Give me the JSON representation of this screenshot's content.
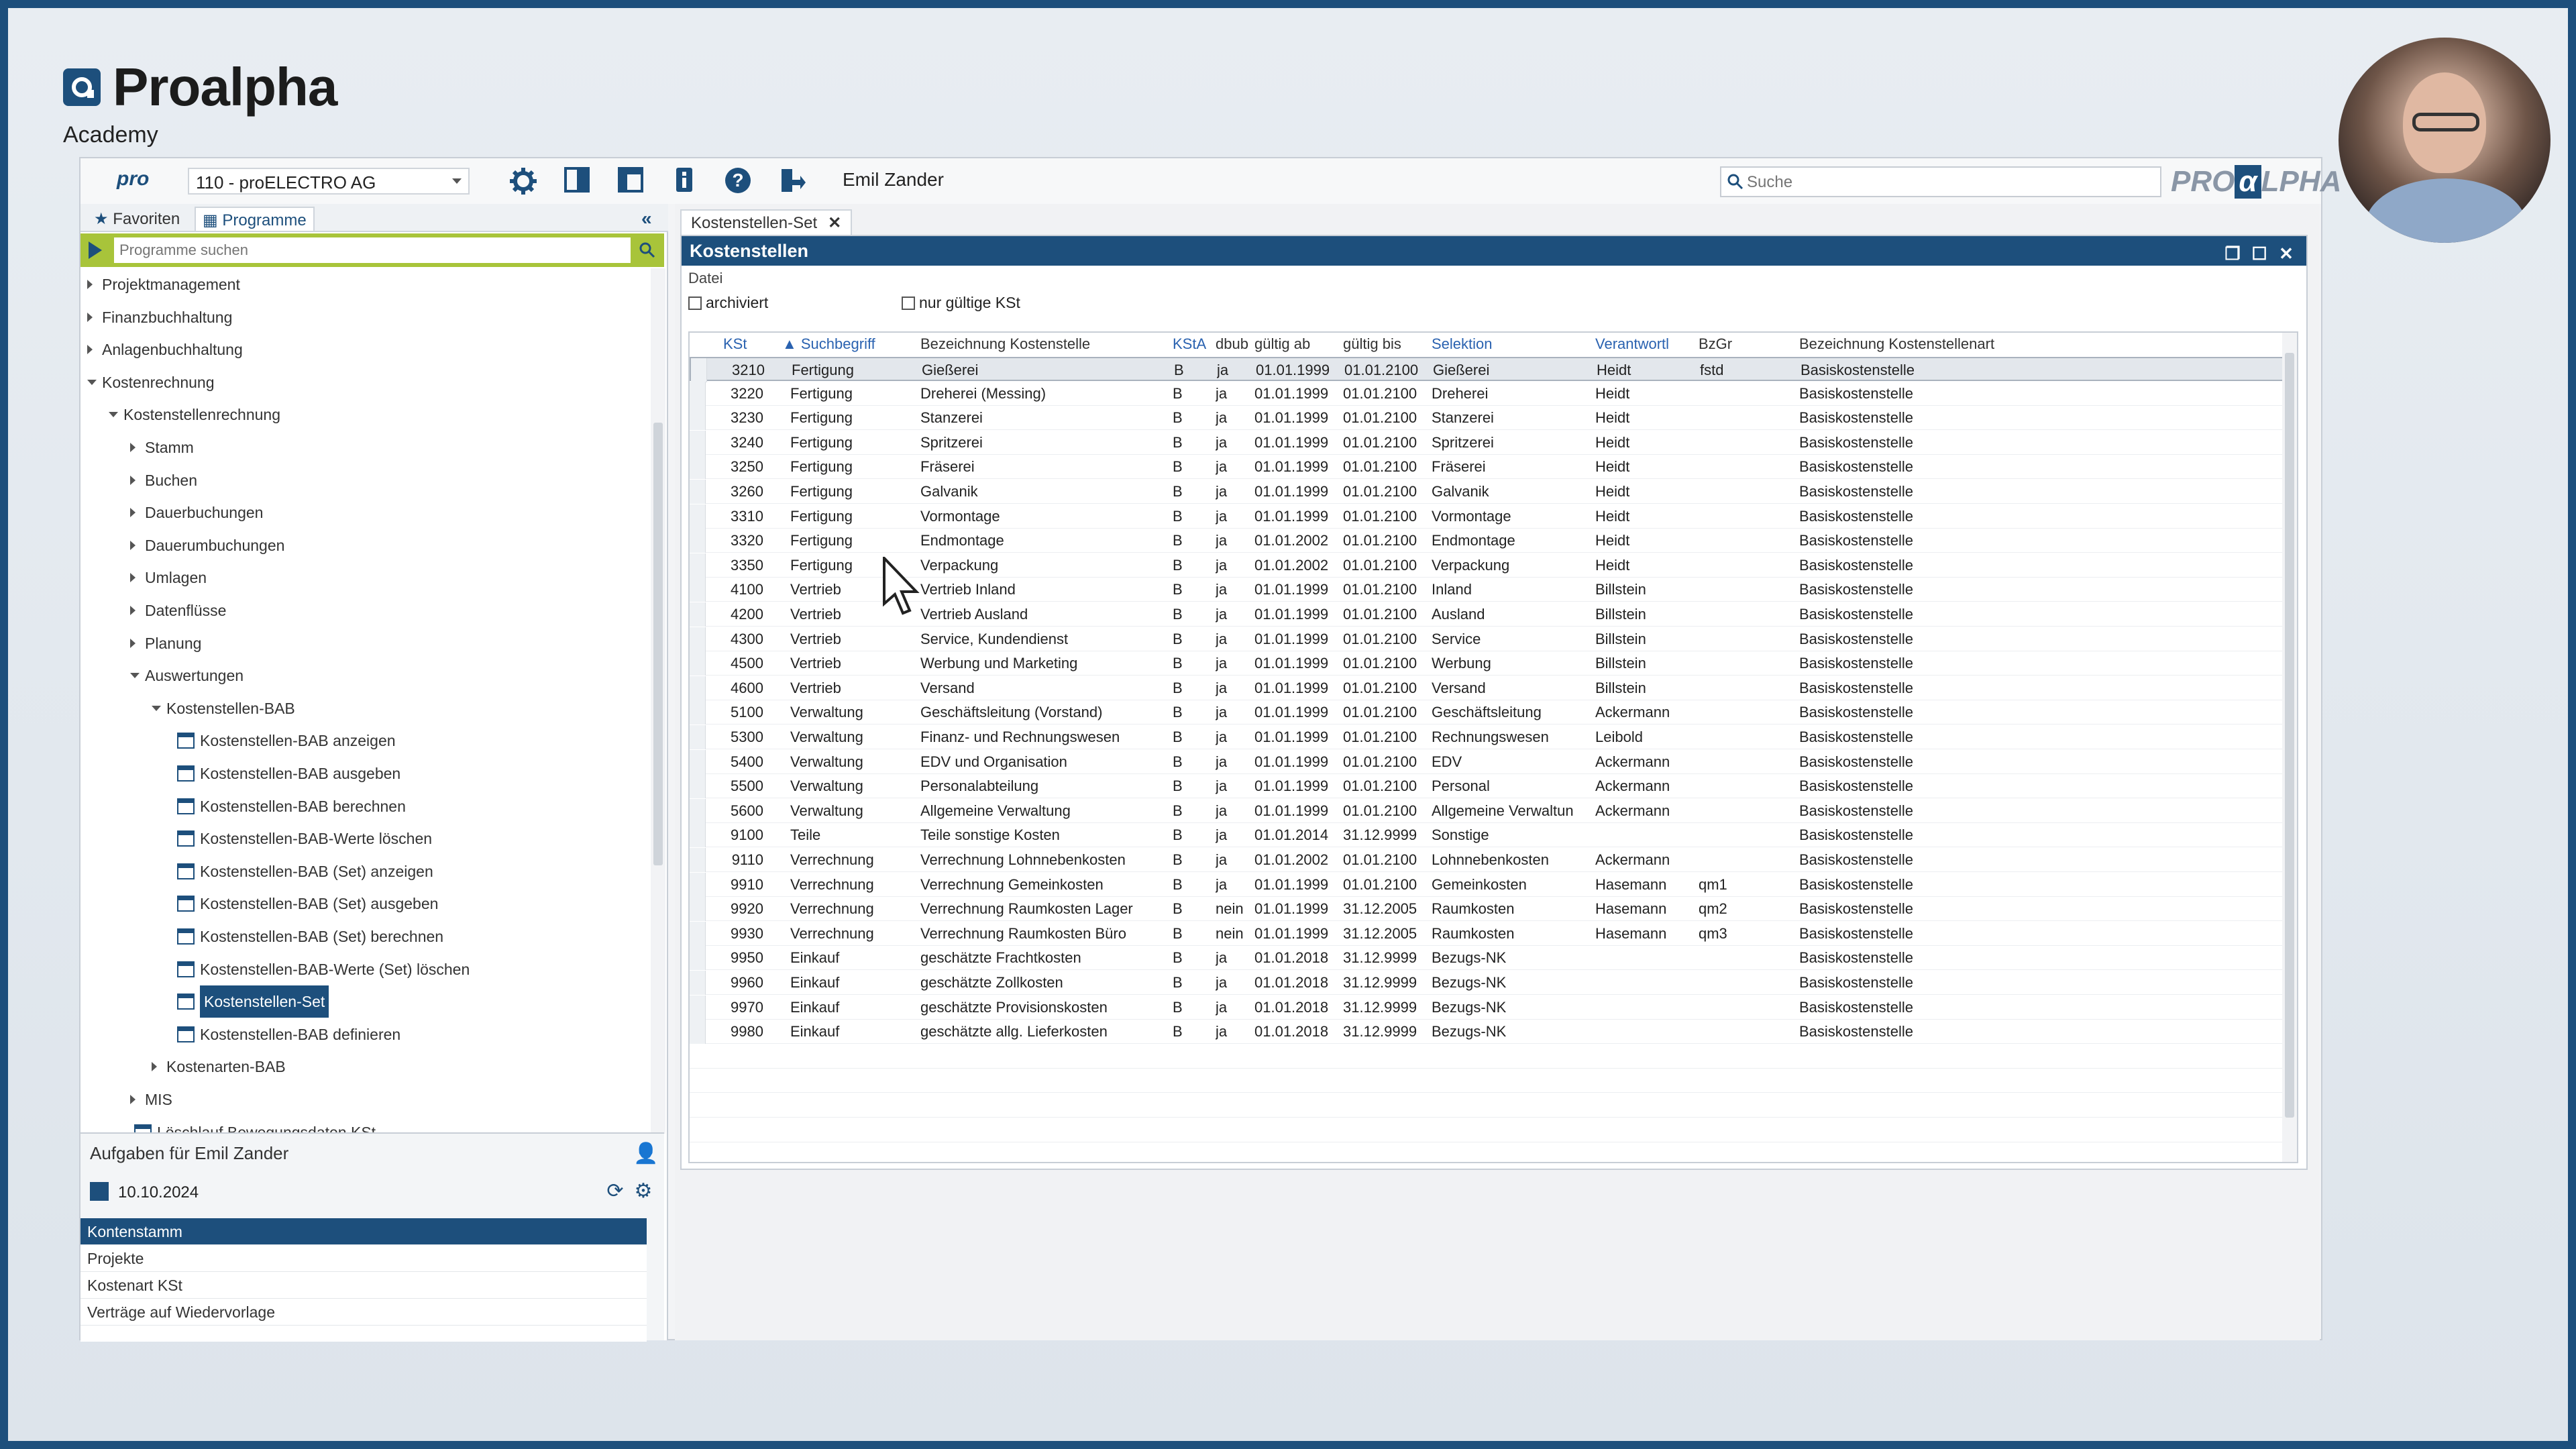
{
  "brand": {
    "name": "Proalpha",
    "sub": "Academy"
  },
  "toolbar": {
    "pro_mark": "pro",
    "company": "110 - proELECTRO AG",
    "user": "Emil Zander",
    "search_placeholder": "Suche",
    "logo_left": "PRO",
    "logo_alpha": "α",
    "logo_right": "LPHA"
  },
  "left_tabs": {
    "favorites": "Favoriten",
    "programs": "Programme"
  },
  "program_search": {
    "placeholder": "Programme suchen"
  },
  "tree": [
    {
      "label": "Projektmanagement",
      "level": 0,
      "state": "closed"
    },
    {
      "label": "Finanzbuchhaltung",
      "level": 0,
      "state": "closed"
    },
    {
      "label": "Anlagenbuchhaltung",
      "level": 0,
      "state": "closed"
    },
    {
      "label": "Kostenrechnung",
      "level": 0,
      "state": "open"
    },
    {
      "label": "Kostenstellenrechnung",
      "level": 1,
      "state": "open"
    },
    {
      "label": "Stamm",
      "level": 2,
      "state": "closed"
    },
    {
      "label": "Buchen",
      "level": 2,
      "state": "closed"
    },
    {
      "label": "Dauerbuchungen",
      "level": 2,
      "state": "closed"
    },
    {
      "label": "Dauerumbuchungen",
      "level": 2,
      "state": "closed"
    },
    {
      "label": "Umlagen",
      "level": 2,
      "state": "closed"
    },
    {
      "label": "Datenflüsse",
      "level": 2,
      "state": "closed"
    },
    {
      "label": "Planung",
      "level": 2,
      "state": "closed"
    },
    {
      "label": "Auswertungen",
      "level": 2,
      "state": "open"
    },
    {
      "label": "Kostenstellen-BAB",
      "level": 3,
      "state": "open"
    },
    {
      "label": "Kostenstellen-BAB anzeigen",
      "level": 4,
      "state": "leaf"
    },
    {
      "label": "Kostenstellen-BAB ausgeben",
      "level": 4,
      "state": "leaf"
    },
    {
      "label": "Kostenstellen-BAB berechnen",
      "level": 4,
      "state": "leaf"
    },
    {
      "label": "Kostenstellen-BAB-Werte löschen",
      "level": 4,
      "state": "leaf"
    },
    {
      "label": "Kostenstellen-BAB (Set) anzeigen",
      "level": 4,
      "state": "leaf"
    },
    {
      "label": "Kostenstellen-BAB (Set) ausgeben",
      "level": 4,
      "state": "leaf"
    },
    {
      "label": "Kostenstellen-BAB (Set) berechnen",
      "level": 4,
      "state": "leaf"
    },
    {
      "label": "Kostenstellen-BAB-Werte (Set) löschen",
      "level": 4,
      "state": "leaf"
    },
    {
      "label": "Kostenstellen-Set",
      "level": 4,
      "state": "leaf-selected"
    },
    {
      "label": "Kostenstellen-BAB definieren",
      "level": 4,
      "state": "leaf"
    },
    {
      "label": "Kostenarten-BAB",
      "level": 3,
      "state": "closed"
    },
    {
      "label": "MIS",
      "level": 2,
      "state": "closed"
    },
    {
      "label": "Löschlauf Bewegungsdaten KSt",
      "level": 2,
      "state": "leaf"
    }
  ],
  "tasks": {
    "title": "Aufgaben für Emil Zander",
    "date": "10.10.2024",
    "items": [
      "Kontenstamm",
      "Projekte",
      "Kostenart KSt",
      "Verträge auf Wiedervorlage"
    ]
  },
  "doc_tab": "Kostenstellen-Set",
  "panel": {
    "title": "Kostenstellen",
    "menu": "Datei",
    "check_archived": "archiviert",
    "check_valid": "nur gültige KSt"
  },
  "columns": [
    "KSt",
    "Suchbegriff",
    "Bezeichnung Kostenstelle",
    "KStA",
    "dbub",
    "gültig ab",
    "gültig bis",
    "Selektion",
    "Verantwortl",
    "BzGr",
    "Bezeichnung Kostenstellenart"
  ],
  "rows": [
    [
      "3210",
      "Fertigung",
      "Gießerei",
      "B",
      "ja",
      "01.01.1999",
      "01.01.2100",
      "Gießerei",
      "Heidt",
      "fstd",
      "Basiskostenstelle"
    ],
    [
      "3220",
      "Fertigung",
      "Dreherei (Messing)",
      "B",
      "ja",
      "01.01.1999",
      "01.01.2100",
      "Dreherei",
      "Heidt",
      "",
      "Basiskostenstelle"
    ],
    [
      "3230",
      "Fertigung",
      "Stanzerei",
      "B",
      "ja",
      "01.01.1999",
      "01.01.2100",
      "Stanzerei",
      "Heidt",
      "",
      "Basiskostenstelle"
    ],
    [
      "3240",
      "Fertigung",
      "Spritzerei",
      "B",
      "ja",
      "01.01.1999",
      "01.01.2100",
      "Spritzerei",
      "Heidt",
      "",
      "Basiskostenstelle"
    ],
    [
      "3250",
      "Fertigung",
      "Fräserei",
      "B",
      "ja",
      "01.01.1999",
      "01.01.2100",
      "Fräserei",
      "Heidt",
      "",
      "Basiskostenstelle"
    ],
    [
      "3260",
      "Fertigung",
      "Galvanik",
      "B",
      "ja",
      "01.01.1999",
      "01.01.2100",
      "Galvanik",
      "Heidt",
      "",
      "Basiskostenstelle"
    ],
    [
      "3310",
      "Fertigung",
      "Vormontage",
      "B",
      "ja",
      "01.01.1999",
      "01.01.2100",
      "Vormontage",
      "Heidt",
      "",
      "Basiskostenstelle"
    ],
    [
      "3320",
      "Fertigung",
      "Endmontage",
      "B",
      "ja",
      "01.01.2002",
      "01.01.2100",
      "Endmontage",
      "Heidt",
      "",
      "Basiskostenstelle"
    ],
    [
      "3350",
      "Fertigung",
      "Verpackung",
      "B",
      "ja",
      "01.01.2002",
      "01.01.2100",
      "Verpackung",
      "Heidt",
      "",
      "Basiskostenstelle"
    ],
    [
      "4100",
      "Vertrieb",
      "Vertrieb Inland",
      "B",
      "ja",
      "01.01.1999",
      "01.01.2100",
      "Inland",
      "Billstein",
      "",
      "Basiskostenstelle"
    ],
    [
      "4200",
      "Vertrieb",
      "Vertrieb Ausland",
      "B",
      "ja",
      "01.01.1999",
      "01.01.2100",
      "Ausland",
      "Billstein",
      "",
      "Basiskostenstelle"
    ],
    [
      "4300",
      "Vertrieb",
      "Service, Kundendienst",
      "B",
      "ja",
      "01.01.1999",
      "01.01.2100",
      "Service",
      "Billstein",
      "",
      "Basiskostenstelle"
    ],
    [
      "4500",
      "Vertrieb",
      "Werbung und Marketing",
      "B",
      "ja",
      "01.01.1999",
      "01.01.2100",
      "Werbung",
      "Billstein",
      "",
      "Basiskostenstelle"
    ],
    [
      "4600",
      "Vertrieb",
      "Versand",
      "B",
      "ja",
      "01.01.1999",
      "01.01.2100",
      "Versand",
      "Billstein",
      "",
      "Basiskostenstelle"
    ],
    [
      "5100",
      "Verwaltung",
      "Geschäftsleitung (Vorstand)",
      "B",
      "ja",
      "01.01.1999",
      "01.01.2100",
      "Geschäftsleitung",
      "Ackermann",
      "",
      "Basiskostenstelle"
    ],
    [
      "5300",
      "Verwaltung",
      "Finanz- und Rechnungswesen",
      "B",
      "ja",
      "01.01.1999",
      "01.01.2100",
      "Rechnungswesen",
      "Leibold",
      "",
      "Basiskostenstelle"
    ],
    [
      "5400",
      "Verwaltung",
      "EDV und Organisation",
      "B",
      "ja",
      "01.01.1999",
      "01.01.2100",
      "EDV",
      "Ackermann",
      "",
      "Basiskostenstelle"
    ],
    [
      "5500",
      "Verwaltung",
      "Personalabteilung",
      "B",
      "ja",
      "01.01.1999",
      "01.01.2100",
      "Personal",
      "Ackermann",
      "",
      "Basiskostenstelle"
    ],
    [
      "5600",
      "Verwaltung",
      "Allgemeine Verwaltung",
      "B",
      "ja",
      "01.01.1999",
      "01.01.2100",
      "Allgemeine Verwaltun",
      "Ackermann",
      "",
      "Basiskostenstelle"
    ],
    [
      "9100",
      "Teile",
      "Teile sonstige Kosten",
      "B",
      "ja",
      "01.01.2014",
      "31.12.9999",
      "Sonstige",
      "",
      "",
      "Basiskostenstelle"
    ],
    [
      "9110",
      "Verrechnung",
      "Verrechnung Lohnnebenkosten",
      "B",
      "ja",
      "01.01.2002",
      "01.01.2100",
      "Lohnnebenkosten",
      "Ackermann",
      "",
      "Basiskostenstelle"
    ],
    [
      "9910",
      "Verrechnung",
      "Verrechnung Gemeinkosten",
      "B",
      "ja",
      "01.01.1999",
      "01.01.2100",
      "Gemeinkosten",
      "Hasemann",
      "qm1",
      "Basiskostenstelle"
    ],
    [
      "9920",
      "Verrechnung",
      "Verrechnung Raumkosten Lager",
      "B",
      "nein",
      "01.01.1999",
      "31.12.2005",
      "Raumkosten",
      "Hasemann",
      "qm2",
      "Basiskostenstelle"
    ],
    [
      "9930",
      "Verrechnung",
      "Verrechnung Raumkosten Büro",
      "B",
      "nein",
      "01.01.1999",
      "31.12.2005",
      "Raumkosten",
      "Hasemann",
      "qm3",
      "Basiskostenstelle"
    ],
    [
      "9950",
      "Einkauf",
      "geschätzte Frachtkosten",
      "B",
      "ja",
      "01.01.2018",
      "31.12.9999",
      "Bezugs-NK",
      "",
      "",
      "Basiskostenstelle"
    ],
    [
      "9960",
      "Einkauf",
      "geschätzte Zollkosten",
      "B",
      "ja",
      "01.01.2018",
      "31.12.9999",
      "Bezugs-NK",
      "",
      "",
      "Basiskostenstelle"
    ],
    [
      "9970",
      "Einkauf",
      "geschätzte Provisionskosten",
      "B",
      "ja",
      "01.01.2018",
      "31.12.9999",
      "Bezugs-NK",
      "",
      "",
      "Basiskostenstelle"
    ],
    [
      "9980",
      "Einkauf",
      "geschätzte allg. Lieferkosten",
      "B",
      "ja",
      "01.01.2018",
      "31.12.9999",
      "Bezugs-NK",
      "",
      "",
      "Basiskostenstelle"
    ]
  ],
  "colors": {
    "primary": "#1d4f7c",
    "accent_green": "#a8c43a",
    "link": "#2a62b0"
  }
}
